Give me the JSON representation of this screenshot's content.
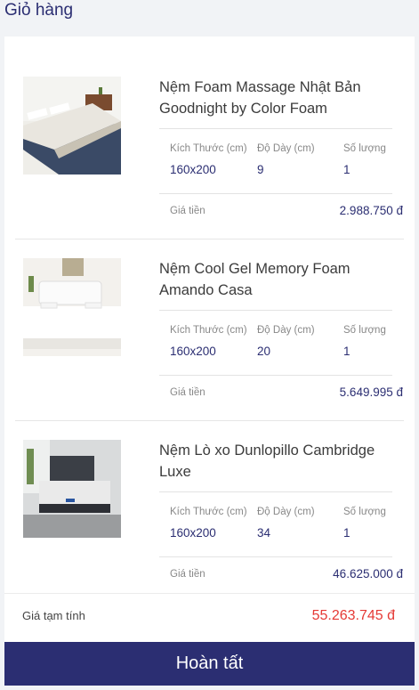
{
  "header": {
    "title": "Giỏ hàng"
  },
  "columns": {
    "size_label": "Kích Thước (cm)",
    "thickness_label": "Độ Dày (cm)",
    "qty_label": "Số lượng",
    "price_label": "Giá tiền"
  },
  "items": [
    {
      "name_line1": "Nệm Foam Massage Nhật Bản",
      "name_line2": "Goodnight by Color Foam",
      "size": "160x200",
      "thickness": "9",
      "qty": "1",
      "price": "2.988.750 đ"
    },
    {
      "name_line1": "Nệm Cool Gel Memory Foam",
      "name_line2": "Amando Casa",
      "size": "160x200",
      "thickness": "20",
      "qty": "1",
      "price": "5.649.995 đ"
    },
    {
      "name_line1": "Nệm Lò xo Dunlopillo Cambridge",
      "name_line2": "Luxe",
      "size": "160x200",
      "thickness": "34",
      "qty": "1",
      "price": "46.625.000 đ"
    }
  ],
  "summary": {
    "subtotal_label": "Giá tạm tính",
    "subtotal_value": "55.263.745 đ"
  },
  "actions": {
    "done_label": "Hoàn tất"
  },
  "colors": {
    "brand": "#2b2e72",
    "total": "#e53935"
  }
}
